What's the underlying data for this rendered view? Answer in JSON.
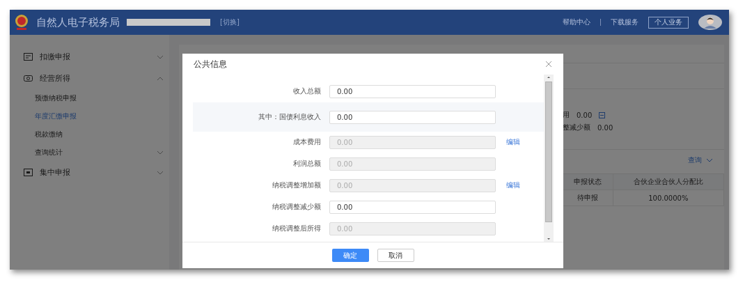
{
  "header": {
    "title": "自然人电子税务局",
    "switch_link": "[切换]",
    "links": [
      "帮助中心",
      "下载服务"
    ],
    "business_button": "个人业务"
  },
  "sidebar": {
    "items": [
      {
        "label": "扣缴申报",
        "selected": false,
        "expanded": false
      },
      {
        "label": "经营所得",
        "selected": false,
        "expanded": true,
        "children": [
          {
            "label": "预缴纳税申报",
            "selected": false
          },
          {
            "label": "年度汇缴申报",
            "selected": true
          },
          {
            "label": "税款缴纳",
            "selected": false
          },
          {
            "label": "查询统计",
            "selected": false,
            "expanded": false
          }
        ]
      },
      {
        "label": "集中申报",
        "selected": false,
        "expanded": false
      }
    ]
  },
  "background_page": {
    "summary": [
      {
        "label": "用",
        "value": "0.00",
        "edit_icon": true
      },
      {
        "label": "整减少额",
        "value": "0.00"
      }
    ],
    "query_link": "查询",
    "table": {
      "columns": [
        "申报状态",
        "合伙企业合伙人分配比"
      ],
      "rows": [
        [
          "待申报",
          "100.0000%"
        ]
      ]
    }
  },
  "modal": {
    "title": "公共信息",
    "fields": [
      {
        "label": "收入总额",
        "value": "0.00",
        "disabled": false,
        "highlighted": false
      },
      {
        "label": "其中：国债利息收入",
        "value": "0.00",
        "disabled": false,
        "highlighted": true
      },
      {
        "label": "成本费用",
        "value": "0.00",
        "disabled": true,
        "highlighted": false,
        "action": "编辑"
      },
      {
        "label": "利润总额",
        "value": "0.00",
        "disabled": true,
        "highlighted": false
      },
      {
        "label": "纳税调整增加额",
        "value": "0.00",
        "disabled": true,
        "highlighted": false,
        "action": "编辑"
      },
      {
        "label": "纳税调整减少额",
        "value": "0.00",
        "disabled": false,
        "highlighted": false
      },
      {
        "label": "纳税调整后所得",
        "value": "0.00",
        "disabled": true,
        "highlighted": false
      }
    ],
    "buttons": [
      {
        "label": "确定",
        "kind": "primary"
      },
      {
        "label": "取消",
        "kind": "default"
      }
    ]
  }
}
